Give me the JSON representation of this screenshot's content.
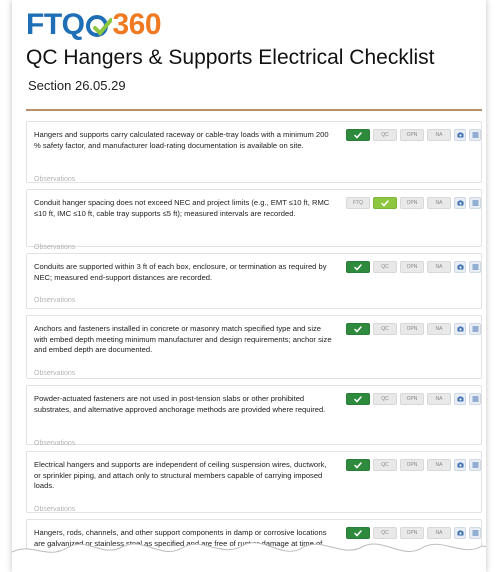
{
  "logo": {
    "left": "FTQ",
    "right": "360"
  },
  "title": "QC Hangers & Supports Electrical Checklist",
  "section": "Section 26.05.29",
  "observations_placeholder": "Observations",
  "button_labels": {
    "ftq": "FTQ",
    "qc": "QC",
    "opn": "OPN",
    "na": "NA"
  },
  "colors": {
    "ftq_blue": "#1f6fb6",
    "orange": "#f07a22",
    "green": "#2e8b3e",
    "lime": "#8dc63f",
    "rule": "#b8916b"
  },
  "items": [
    {
      "text": "Hangers and supports carry calculated raceway or cable-tray loads with a minimum 200 % safety factor, and manufacturer load-rating documentation is available on site.",
      "selected": "FTQ"
    },
    {
      "text": "Conduit hanger spacing does not exceed NEC and project limits (e.g., EMT ≤10 ft, RMC ≤10 ft, IMC ≤10 ft, cable tray supports ≤5 ft); measured intervals are recorded.",
      "selected": "QC"
    },
    {
      "text": "Conduits are supported within 3 ft of each box, enclosure, or termination as required by NEC; measured end-support distances are recorded.",
      "selected": "FTQ"
    },
    {
      "text": "Anchors and fasteners installed in concrete or masonry match specified type and size with embed depth meeting minimum manufacturer and design requirements; anchor size and embed depth are documented.",
      "selected": "FTQ"
    },
    {
      "text": "Powder-actuated fasteners are not used in post-tension slabs or other prohibited substrates, and alternative approved anchorage methods are provided where required.",
      "selected": "FTQ"
    },
    {
      "text": "Electrical hangers and supports are independent of ceiling suspension wires, ductwork, or sprinkler piping, and attach only to structural members capable of carrying imposed loads.",
      "selected": "FTQ"
    },
    {
      "text": "Hangers, rods, channels, and other support components in damp or corrosive locations are galvanized or stainless steel as specified and are free of rust or damage at time of inspection.",
      "selected": "FTQ"
    }
  ]
}
